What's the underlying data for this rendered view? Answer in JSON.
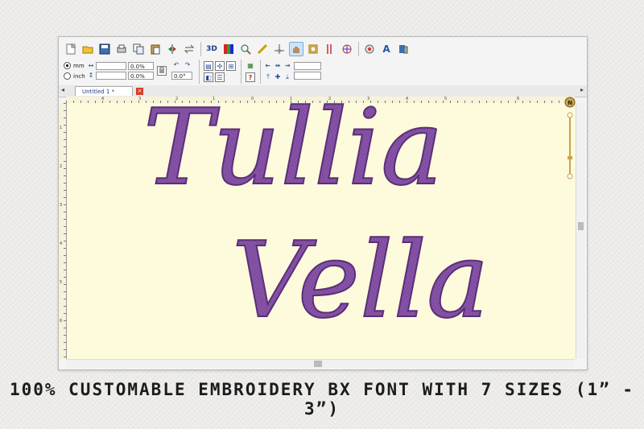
{
  "toolbar": {
    "view_3d_label": "3D"
  },
  "units": {
    "mm_label": "mm",
    "inch_label": "inch",
    "selected": "mm"
  },
  "fields": {
    "width_value": "",
    "height_value": "",
    "width_percent": "0.0%",
    "height_percent": "0.0%",
    "rotation": "0.0°"
  },
  "tab": {
    "title": "Untitled 1 *"
  },
  "ruler": {
    "top_numbers": [
      "4",
      "3",
      "2",
      "1",
      "0",
      "1",
      "2",
      "3",
      "4",
      "5",
      "6"
    ],
    "left_numbers": [
      "1",
      "2",
      "3",
      "4",
      "5",
      "6"
    ]
  },
  "canvas": {
    "line1": "Tullia",
    "line2": "Vella",
    "stitch_color": "#7d4a9c",
    "stitch_shadow": "#5a2f78",
    "background_color": "#fefbdc"
  },
  "compass": {
    "north_label": "N"
  },
  "caption": {
    "text": "100% CUSTOMABLE EMBROIDERY BX FONT WITH 7 SIZES (1” -  3”)"
  }
}
